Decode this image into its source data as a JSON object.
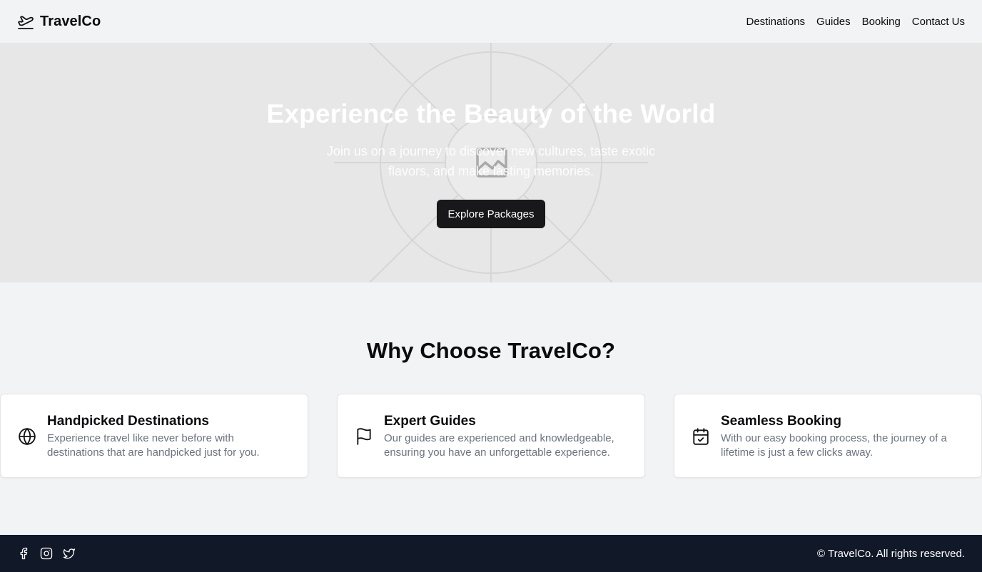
{
  "header": {
    "logo_icon": "plane-takeoff-icon",
    "brand": "TravelCo",
    "nav": [
      {
        "label": "Destinations"
      },
      {
        "label": "Guides"
      },
      {
        "label": "Booking"
      },
      {
        "label": "Contact Us"
      }
    ]
  },
  "hero": {
    "title": "Experience the Beauty of the World",
    "subtitle": "Join us on a journey to discover new cultures, taste exotic flavors, and make lasting memories.",
    "cta": "Explore Packages",
    "background_icon": "image-placeholder-icon"
  },
  "features": {
    "heading": "Why Choose TravelCo?",
    "cards": [
      {
        "icon": "globe-icon",
        "title": "Handpicked Destinations",
        "description": "Experience travel like never before with destinations that are handpicked just for you."
      },
      {
        "icon": "flag-icon",
        "title": "Expert Guides",
        "description": "Our guides are experienced and knowledgeable, ensuring you have an unforgettable experience."
      },
      {
        "icon": "calendar-check-icon",
        "title": "Seamless Booking",
        "description": "With our easy booking process, the journey of a lifetime is just a few clicks away."
      }
    ]
  },
  "footer": {
    "social": [
      "facebook-icon",
      "instagram-icon",
      "twitter-icon"
    ],
    "copyright": "© TravelCo. All rights reserved."
  },
  "colors": {
    "background": "#f2f3f5",
    "hero_background": "#e7e7e7",
    "button": "#18181b",
    "footer": "#111827",
    "muted_text": "#6b7280"
  }
}
